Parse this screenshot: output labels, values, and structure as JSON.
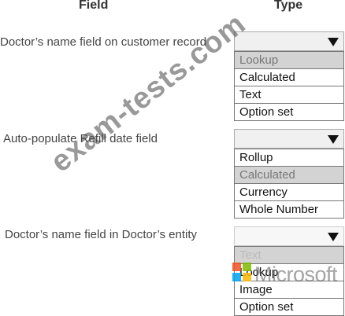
{
  "headers": {
    "field": "Field",
    "type": "Type"
  },
  "rows": [
    {
      "label": "Doctor’s name field on customer record",
      "options": [
        "Lookup",
        "Calculated",
        "Text",
        "Option set"
      ],
      "selected": "Lookup"
    },
    {
      "label": "Auto-populate Refill date field",
      "options": [
        "Rollup",
        "Calculated",
        "Currency",
        "Whole Number"
      ],
      "selected": "Calculated"
    },
    {
      "label": "Doctor’s name field in Doctor’s entity",
      "options": [
        "Text",
        "Lookup",
        "Image",
        "Option set"
      ],
      "selected": "Text"
    }
  ],
  "watermark": "exam-tests.com",
  "brand": {
    "name": "Microsoft",
    "logo_colors": [
      "#f25022",
      "#7fba00",
      "#00a4ef",
      "#ffb900"
    ]
  },
  "icons": {
    "dropdown": "chevron-down-icon",
    "logo": "microsoft-logo-icon"
  }
}
